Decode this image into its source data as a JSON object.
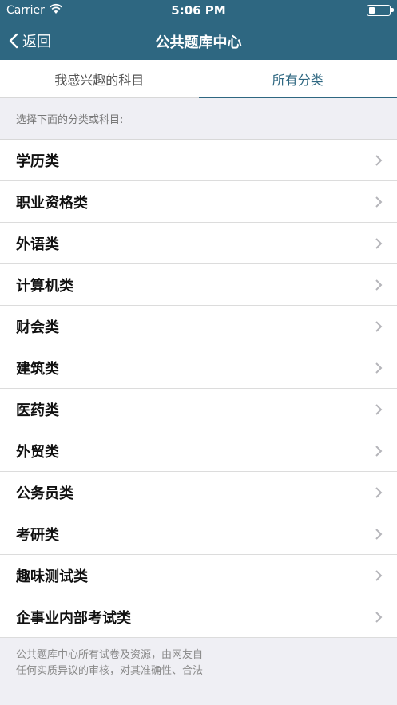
{
  "status_bar": {
    "carrier": "Carrier",
    "time": "5:06 PM"
  },
  "navbar": {
    "back_label": "返回",
    "title": "公共题库中心"
  },
  "tabs": [
    {
      "label": "我感兴趣的科目",
      "active": false
    },
    {
      "label": "所有分类",
      "active": true
    }
  ],
  "section_header": "选择下面的分类或科目:",
  "categories": [
    {
      "label": "学历类"
    },
    {
      "label": "职业资格类"
    },
    {
      "label": "外语类"
    },
    {
      "label": "计算机类"
    },
    {
      "label": "财会类"
    },
    {
      "label": "建筑类"
    },
    {
      "label": "医药类"
    },
    {
      "label": "外贸类"
    },
    {
      "label": "公务员类"
    },
    {
      "label": "考研类"
    },
    {
      "label": "趣味测试类"
    },
    {
      "label": "企事业内部考试类"
    }
  ],
  "footer": {
    "line1": "公共题库中心所有试卷及资源，由网友自",
    "line2": "任何实质异议的审核，对其准确性、合法"
  },
  "colors": {
    "brand": "#2e6781",
    "background": "#efeff4"
  }
}
